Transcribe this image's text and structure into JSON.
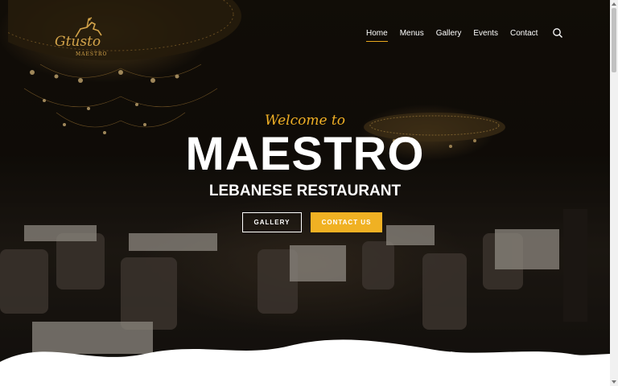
{
  "logo": {
    "script_text": "Gtusto",
    "sub_text": "MAESTRO",
    "icon": "horse-rider-logo-icon"
  },
  "nav": {
    "items": [
      {
        "label": "Home",
        "active": true
      },
      {
        "label": "Menus",
        "active": false
      },
      {
        "label": "Gallery",
        "active": false
      },
      {
        "label": "Events",
        "active": false
      },
      {
        "label": "Contact",
        "active": false
      }
    ],
    "search_icon": "search-icon"
  },
  "hero": {
    "welcome": "Welcome to",
    "title": "MAESTRO",
    "subtitle": "LEBANESE RESTAURANT",
    "buttons": {
      "gallery": "GALLERY",
      "contact": "CONTACT US"
    }
  },
  "colors": {
    "accent": "#f0b123",
    "text": "#ffffff",
    "logo_gold": "#d4a44a"
  }
}
